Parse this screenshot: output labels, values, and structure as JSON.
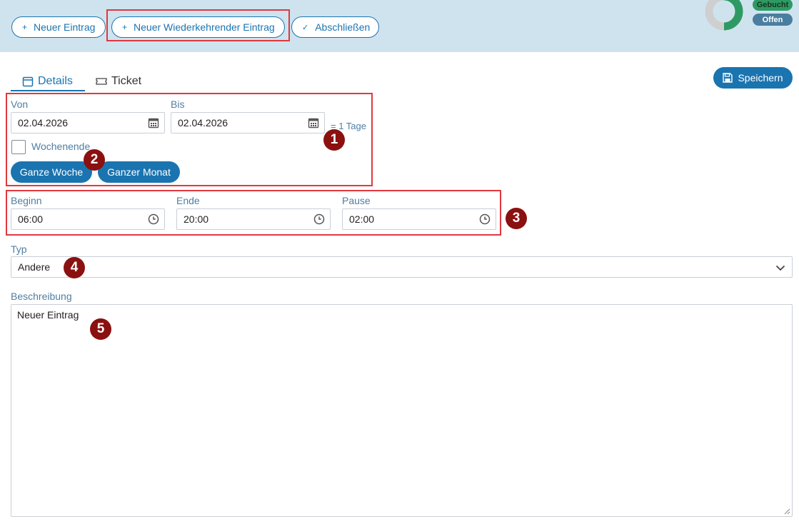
{
  "toolbar": {
    "new_entry": "Neuer Eintrag",
    "new_recurring_entry": "Neuer Wiederkehrender Eintrag",
    "finish": "Abschließen"
  },
  "status": {
    "booked": "Gebucht",
    "open": "Offen",
    "colors": {
      "booked": "#2e9a63",
      "open": "#4a7ea0",
      "donut_track": "#cfcfcf"
    }
  },
  "tabs": [
    {
      "label": "Details",
      "icon": "calendar-icon",
      "active": true
    },
    {
      "label": "Ticket",
      "icon": "ticket-icon",
      "active": false
    }
  ],
  "save_label": "Speichern",
  "date_range": {
    "from_label": "Von",
    "from_value": "02.04.2026",
    "to_label": "Bis",
    "to_value": "02.04.2026",
    "days_text": "= 1 Tage",
    "weekend_label": "Wochenende",
    "weekend_checked": false,
    "whole_week": "Ganze Woche",
    "whole_month": "Ganzer Monat"
  },
  "times": {
    "start_label": "Beginn",
    "start_value": "06:00",
    "end_label": "Ende",
    "end_value": "20:00",
    "pause_label": "Pause",
    "pause_value": "02:00"
  },
  "type": {
    "label": "Typ",
    "value": "Andere"
  },
  "description": {
    "label": "Beschreibung",
    "value": "Neuer Eintrag"
  },
  "annotations": [
    "1",
    "2",
    "3",
    "4",
    "5"
  ],
  "accent": "#1a74b0",
  "highlight_color": "#e0383e",
  "badge_color": "#8b1010"
}
